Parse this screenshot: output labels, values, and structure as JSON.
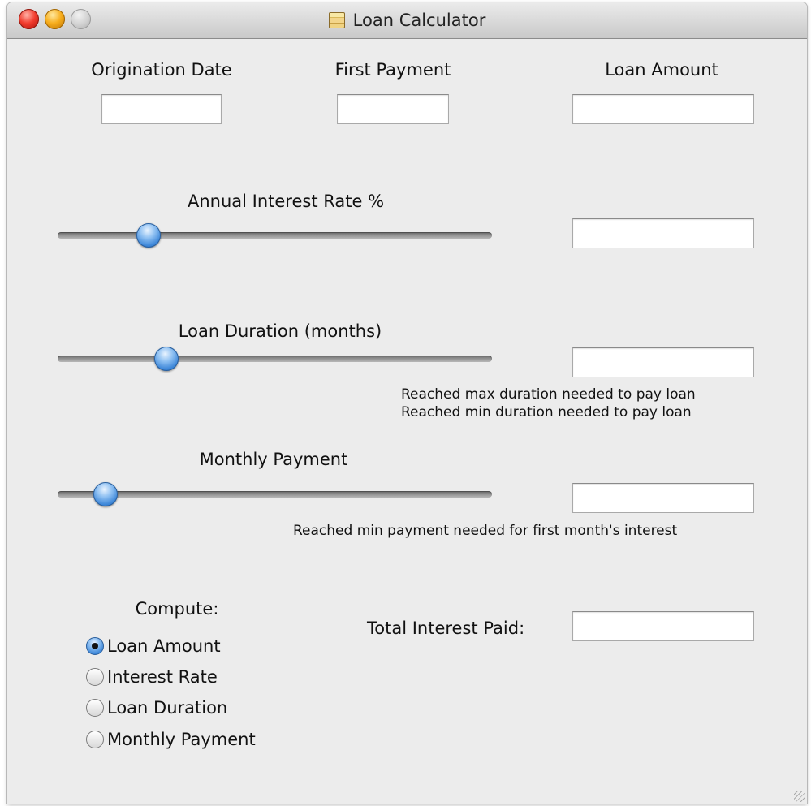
{
  "window": {
    "title": "Loan Calculator"
  },
  "top_fields": {
    "origination_date": {
      "label": "Origination Date",
      "value": ""
    },
    "first_payment": {
      "label": "First Payment",
      "value": ""
    },
    "loan_amount": {
      "label": "Loan Amount",
      "value": ""
    }
  },
  "interest_rate": {
    "label": "Annual Interest Rate %",
    "value": "",
    "slider_level": 0.21
  },
  "duration": {
    "label": "Loan Duration (months)",
    "value": "",
    "slider_level": 0.25,
    "note_max": "Reached max duration needed to pay loan",
    "note_min": "Reached min duration needed to pay loan"
  },
  "payment": {
    "label": "Monthly Payment",
    "value": "",
    "slider_level": 0.11,
    "note": "Reached min payment needed for first month's interest"
  },
  "compute": {
    "label": "Compute:",
    "options": [
      {
        "label": "Loan Amount",
        "checked": true
      },
      {
        "label": "Interest Rate",
        "checked": false
      },
      {
        "label": "Loan Duration",
        "checked": false
      },
      {
        "label": "Monthly Payment",
        "checked": false
      }
    ]
  },
  "total_interest": {
    "label": "Total Interest Paid:",
    "value": ""
  }
}
